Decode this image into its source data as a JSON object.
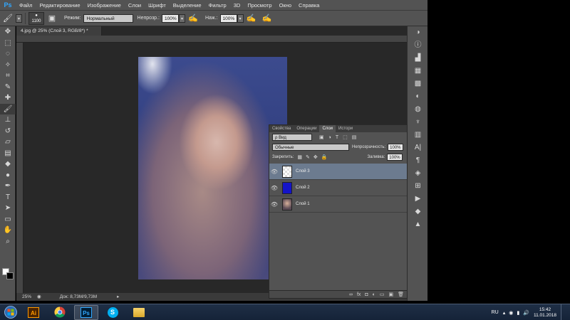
{
  "app": {
    "logo": "Ps",
    "menu": [
      "Файл",
      "Редактирование",
      "Изображение",
      "Слои",
      "Шрифт",
      "Выделение",
      "Фильтр",
      "3D",
      "Просмотр",
      "Окно",
      "Справка"
    ],
    "window_controls": [
      "—",
      "❐",
      "✕"
    ]
  },
  "options_bar": {
    "brush_size": "1100",
    "mode_label": "Режим:",
    "mode_value": "Нормальный",
    "opacity_label": "Непрозр.:",
    "opacity_value": "100%",
    "pressure_label": "Наж.:",
    "pressure_value": "100%"
  },
  "document": {
    "tab_title": "4.jpg @ 25% (Слой 3, RGB/8*) *",
    "zoom": "25%",
    "doc_size": "Док: 8,73M/9,73M"
  },
  "layers_panel": {
    "tabs": [
      "Свойства",
      "Операции",
      "Слои",
      "Истори"
    ],
    "active_tab": "Слои",
    "filter_label": "ρ Вид",
    "blend_mode": "Обычные",
    "opacity_label": "Непрозрачность:",
    "opacity_value": "100%",
    "lock_label": "Закрепить:",
    "fill_label": "Заливка:",
    "fill_value": "100%",
    "layers": [
      {
        "name": "Слой 3",
        "selected": true
      },
      {
        "name": "Слой 2",
        "selected": false
      },
      {
        "name": "Слой 1",
        "selected": false
      }
    ]
  },
  "taskbar": {
    "apps": [
      "illustrator",
      "chrome",
      "photoshop",
      "skype",
      "explorer"
    ],
    "active_app": "photoshop",
    "language": "RU",
    "time": "15:42",
    "date": "11.01.2018"
  },
  "colors": {
    "foreground": "#ffffff",
    "background": "#000000",
    "layer2_fill": "#1414c8",
    "selected_layer": "#6c7b8f"
  }
}
